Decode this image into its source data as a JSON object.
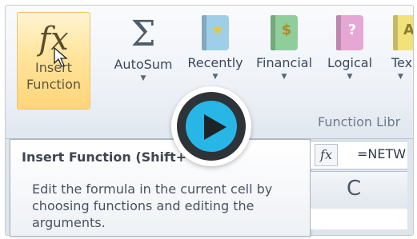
{
  "ribbon": {
    "buttons": [
      {
        "label_line1": "Insert",
        "label_line2": "Function",
        "icon": "fx-icon"
      },
      {
        "label": "AutoSum",
        "icon": "sigma-icon"
      },
      {
        "label": "Recently",
        "icon": "recently-used-book-icon"
      },
      {
        "label": "Financial",
        "icon": "financial-book-icon"
      },
      {
        "label": "Logical",
        "icon": "logical-book-icon"
      },
      {
        "label": "Tex",
        "icon": "text-book-icon"
      }
    ],
    "group_label": "Function Libr"
  },
  "tooltip": {
    "title": "Insert Function (Shift+",
    "body": "Edit the formula in the current cell by choosing functions and editing the arguments."
  },
  "formula_bar": {
    "fx_symbol": "fx",
    "formula": "=NETW"
  },
  "column_header": "C",
  "colors": {
    "accent_highlight": "#ffd57a",
    "play_blue": "#27b6e6",
    "book_blue": "#9fcfe8",
    "book_green": "#8fce9a",
    "book_pink": "#e7a7d4",
    "book_yellow": "#f1e27a"
  }
}
